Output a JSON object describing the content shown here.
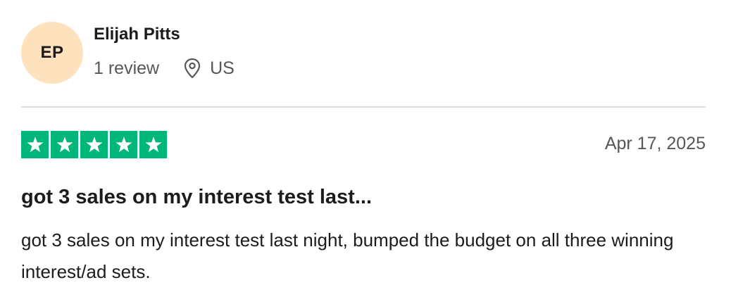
{
  "reviewer": {
    "initials": "EP",
    "name": "Elijah Pitts",
    "review_count": "1 review",
    "location": "US",
    "avatar_color": "#fde2bd"
  },
  "review": {
    "rating": 5,
    "rating_max": 5,
    "star_color": "#00b67a",
    "date": "Apr 17, 2025",
    "title": "got 3 sales on my interest test last...",
    "body": "got 3 sales on my interest test last night, bumped the budget on all three winning interest/ad sets."
  },
  "icons": {
    "location": "map-pin-icon",
    "star": "star-icon"
  }
}
